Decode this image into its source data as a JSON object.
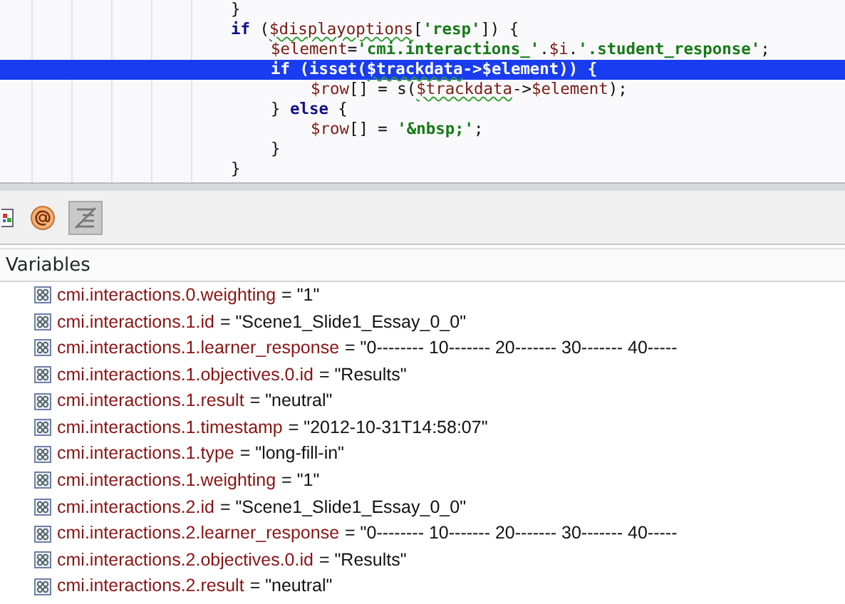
{
  "code_lines": [
    {
      "highlighted": false,
      "segments": [
        {
          "kind": "plain",
          "text": "}"
        }
      ]
    },
    {
      "highlighted": false,
      "segments": [
        {
          "kind": "keyword",
          "text": "if"
        },
        {
          "kind": "plain",
          "text": " ("
        },
        {
          "kind": "variable_warn",
          "text": "$displayoptions"
        },
        {
          "kind": "plain",
          "text": "["
        },
        {
          "kind": "string",
          "text": "'resp'"
        },
        {
          "kind": "plain",
          "text": "]) {"
        }
      ],
      "children": [
        {
          "highlighted": false,
          "segments": [
            {
              "kind": "variable",
              "text": "$element"
            },
            {
              "kind": "plain",
              "text": "="
            },
            {
              "kind": "string",
              "text": "'cmi.interactions_'"
            },
            {
              "kind": "plain",
              "text": "."
            },
            {
              "kind": "variable",
              "text": "$i"
            },
            {
              "kind": "plain",
              "text": "."
            },
            {
              "kind": "string",
              "text": "'.student_response'"
            },
            {
              "kind": "plain",
              "text": ";"
            }
          ]
        },
        {
          "highlighted": true,
          "segments": [
            {
              "kind": "keyword",
              "text": "if"
            },
            {
              "kind": "plain",
              "text": " ("
            },
            {
              "kind": "keyword",
              "text": "isset"
            },
            {
              "kind": "plain",
              "text": "("
            },
            {
              "kind": "variable_warn",
              "text": "$trackdata"
            },
            {
              "kind": "plain",
              "text": "->"
            },
            {
              "kind": "variable",
              "text": "$element"
            },
            {
              "kind": "plain",
              "text": ")) {"
            }
          ],
          "children": [
            {
              "highlighted": false,
              "segments": [
                {
                  "kind": "variable",
                  "text": "$row"
                },
                {
                  "kind": "plain",
                  "text": "[] = s("
                },
                {
                  "kind": "variable_warn",
                  "text": "$trackdata"
                },
                {
                  "kind": "plain",
                  "text": "->"
                },
                {
                  "kind": "variable",
                  "text": "$element"
                },
                {
                  "kind": "plain",
                  "text": ");"
                }
              ]
            }
          ]
        },
        {
          "highlighted": false,
          "segments": [
            {
              "kind": "plain",
              "text": "} "
            },
            {
              "kind": "keyword",
              "text": "else"
            },
            {
              "kind": "plain",
              "text": " {"
            }
          ],
          "children": [
            {
              "highlighted": false,
              "segments": [
                {
                  "kind": "variable",
                  "text": "$row"
                },
                {
                  "kind": "plain",
                  "text": "[] = "
                },
                {
                  "kind": "string",
                  "text": "'&nbsp;'"
                },
                {
                  "kind": "plain",
                  "text": ";"
                }
              ]
            }
          ]
        },
        {
          "highlighted": false,
          "segments": [
            {
              "kind": "plain",
              "text": "}"
            }
          ]
        }
      ]
    },
    {
      "highlighted": false,
      "segments": [
        {
          "kind": "plain",
          "text": "}"
        }
      ]
    }
  ],
  "toolbar": [
    {
      "kind": "grid",
      "selected": false
    },
    {
      "kind": "at",
      "selected": false
    },
    {
      "kind": "lines",
      "selected": true
    }
  ],
  "variables": {
    "title": "Variables",
    "rows": [
      {
        "name": "cmi.interactions.0.weighting",
        "value": "= \"1\""
      },
      {
        "name": "cmi.interactions.1.id",
        "value": "= \"Scene1_Slide1_Essay_0_0\""
      },
      {
        "name": "cmi.interactions.1.learner_response",
        "value": "= \"0-------- 10------- 20------- 30------- 40-----"
      },
      {
        "name": "cmi.interactions.1.objectives.0.id",
        "value": "= \"Results\""
      },
      {
        "name": "cmi.interactions.1.result",
        "value": "= \"neutral\""
      },
      {
        "name": "cmi.interactions.1.timestamp",
        "value": "= \"2012-10-31T14:58:07\""
      },
      {
        "name": "cmi.interactions.1.type",
        "value": "= \"long-fill-in\""
      },
      {
        "name": "cmi.interactions.1.weighting",
        "value": "= \"1\""
      },
      {
        "name": "cmi.interactions.2.id",
        "value": "= \"Scene1_Slide1_Essay_0_0\""
      },
      {
        "name": "cmi.interactions.2.learner_response",
        "value": "= \"0-------- 10------- 20------- 30------- 40-----"
      },
      {
        "name": "cmi.interactions.2.objectives.0.id",
        "value": "= \"Results\""
      },
      {
        "name": "cmi.interactions.2.result",
        "value": "= \"neutral\""
      }
    ]
  }
}
